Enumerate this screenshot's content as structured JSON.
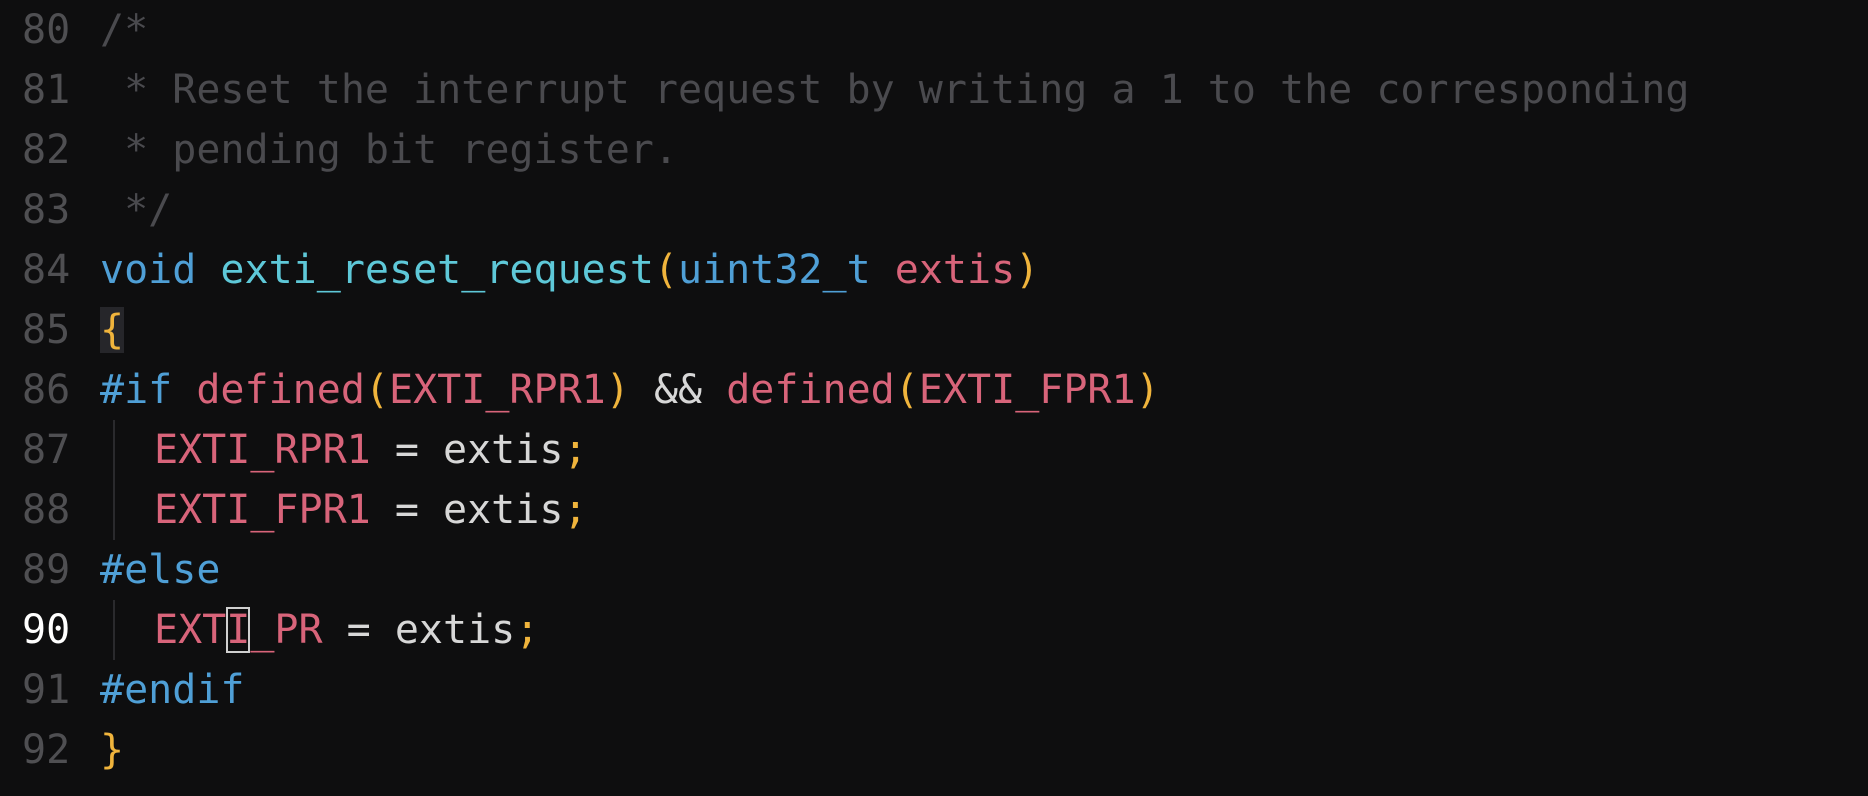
{
  "editor": {
    "current_line": "90",
    "lines": [
      {
        "num": "80",
        "tokens": [
          {
            "t": "/*",
            "c": "comment"
          }
        ]
      },
      {
        "num": "81",
        "tokens": [
          {
            "t": " * Reset the interrupt request by writing a 1 to the corresponding",
            "c": "comment"
          }
        ]
      },
      {
        "num": "82",
        "tokens": [
          {
            "t": " * pending bit register.",
            "c": "comment"
          }
        ]
      },
      {
        "num": "83",
        "tokens": [
          {
            "t": " */",
            "c": "comment"
          }
        ]
      },
      {
        "num": "84",
        "tokens": [
          {
            "t": "void",
            "c": "type"
          },
          {
            "t": " ",
            "c": "plain"
          },
          {
            "t": "exti_reset_request",
            "c": "func"
          },
          {
            "t": "(",
            "c": "paren"
          },
          {
            "t": "uint32_t",
            "c": "type"
          },
          {
            "t": " ",
            "c": "plain"
          },
          {
            "t": "extis",
            "c": "param"
          },
          {
            "t": ")",
            "c": "paren"
          }
        ]
      },
      {
        "num": "85",
        "tokens": [
          {
            "t": "{",
            "c": "paren",
            "hl": true
          }
        ]
      },
      {
        "num": "86",
        "tokens": [
          {
            "t": "#if",
            "c": "pre"
          },
          {
            "t": " ",
            "c": "plain"
          },
          {
            "t": "defined",
            "c": "macro"
          },
          {
            "t": "(",
            "c": "paren"
          },
          {
            "t": "EXTI_RPR1",
            "c": "macro"
          },
          {
            "t": ")",
            "c": "paren"
          },
          {
            "t": " && ",
            "c": "op"
          },
          {
            "t": "defined",
            "c": "macro"
          },
          {
            "t": "(",
            "c": "paren"
          },
          {
            "t": "EXTI_FPR1",
            "c": "macro"
          },
          {
            "t": ")",
            "c": "paren"
          }
        ]
      },
      {
        "num": "87",
        "indent": true,
        "tokens": [
          {
            "t": "EXTI_RPR1",
            "c": "macro"
          },
          {
            "t": " = ",
            "c": "op"
          },
          {
            "t": "extis",
            "c": "plain"
          },
          {
            "t": ";",
            "c": "punct"
          }
        ]
      },
      {
        "num": "88",
        "indent": true,
        "tokens": [
          {
            "t": "EXTI_FPR1",
            "c": "macro"
          },
          {
            "t": " = ",
            "c": "op"
          },
          {
            "t": "extis",
            "c": "plain"
          },
          {
            "t": ";",
            "c": "punct"
          }
        ]
      },
      {
        "num": "89",
        "tokens": [
          {
            "t": "#else",
            "c": "pre"
          }
        ]
      },
      {
        "num": "90",
        "indent": true,
        "tokens": [
          {
            "t": "EXT",
            "c": "macro"
          },
          {
            "t": "I",
            "c": "macro",
            "cursor": true
          },
          {
            "t": "_PR",
            "c": "macro"
          },
          {
            "t": " = ",
            "c": "op"
          },
          {
            "t": "extis",
            "c": "plain"
          },
          {
            "t": ";",
            "c": "punct"
          }
        ]
      },
      {
        "num": "91",
        "tokens": [
          {
            "t": "#endif",
            "c": "pre"
          }
        ]
      },
      {
        "num": "92",
        "tokens": [
          {
            "t": "}",
            "c": "paren"
          }
        ]
      }
    ]
  }
}
